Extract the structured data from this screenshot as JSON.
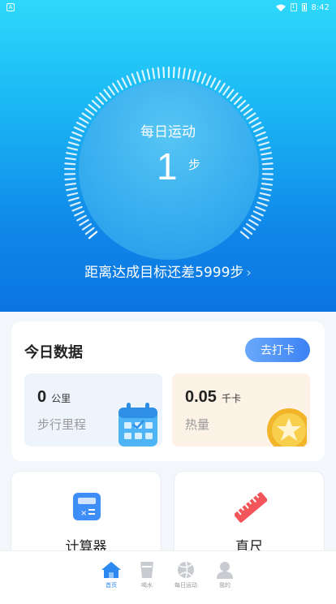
{
  "status_bar": {
    "time": "8:42",
    "left_badge": "A",
    "sim_label": "1"
  },
  "hero": {
    "title": "每日运动",
    "steps": "1",
    "steps_unit": "步",
    "goal_text": "距离达成目标还差5999步",
    "goal_chevron": "›",
    "progress_fraction": 0.0002
  },
  "today": {
    "title": "今日数据",
    "checkin_label": "去打卡",
    "distance": {
      "value": "0",
      "unit": "公里",
      "label": "步行里程",
      "icon": "calendar-icon"
    },
    "calories": {
      "value": "0.05",
      "unit": "千卡",
      "label": "热量",
      "icon": "star-coin-icon"
    }
  },
  "tools": [
    {
      "label": "计算器",
      "icon": "calculator-icon"
    },
    {
      "label": "直尺",
      "icon": "ruler-icon"
    }
  ],
  "tabs": [
    {
      "label": "首页",
      "icon": "home-icon",
      "active": true
    },
    {
      "label": "喝水",
      "icon": "cup-icon",
      "active": false
    },
    {
      "label": "每日运动",
      "icon": "ball-icon",
      "active": false
    },
    {
      "label": "我的",
      "icon": "person-icon",
      "active": false
    }
  ],
  "colors": {
    "accent": "#2c89f0",
    "hero_top": "#2ed8fb",
    "hero_bottom": "#0b74e0",
    "ruler": "#f2555a"
  }
}
